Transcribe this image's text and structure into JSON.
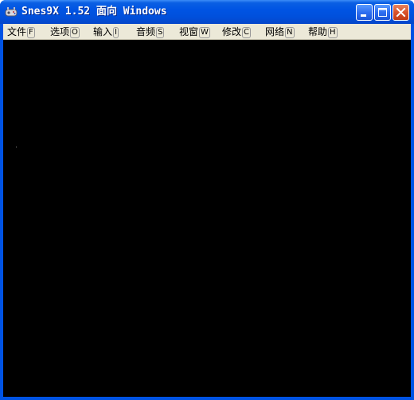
{
  "window": {
    "title": "Snes9X 1.52 面向 Windows",
    "icon": "snes9x-app-icon",
    "controls": {
      "minimize_icon": "minimize-icon",
      "maximize_icon": "maximize-icon",
      "close_icon": "close-icon"
    }
  },
  "menu": [
    {
      "label": "文件",
      "key": "F"
    },
    {
      "label": "选项",
      "key": "O"
    },
    {
      "label": "输入",
      "key": "I"
    },
    {
      "label": "音频",
      "key": "S"
    },
    {
      "label": "视窗",
      "key": "W"
    },
    {
      "label": "修改",
      "key": "C"
    },
    {
      "label": "网络",
      "key": "N"
    },
    {
      "label": "帮助",
      "key": "H"
    }
  ],
  "colors": {
    "titlebar": "#0054e3",
    "menubar": "#ece9d8",
    "display": "#000000",
    "close_button": "#d9532c"
  }
}
